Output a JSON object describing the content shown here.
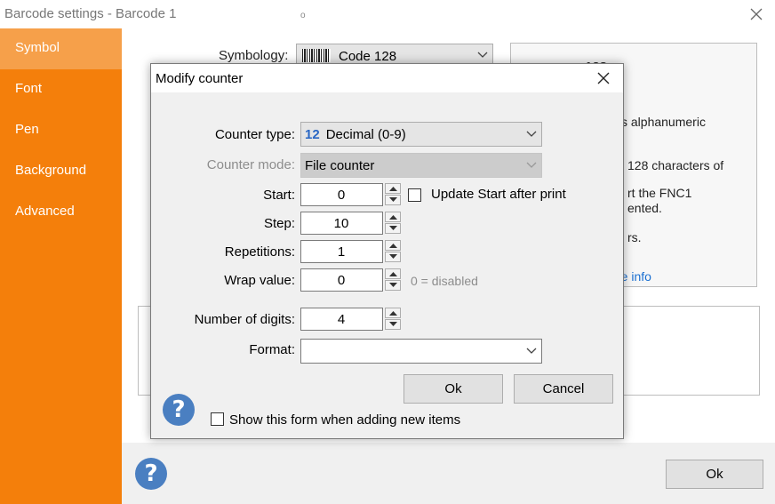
{
  "window": {
    "title": "Barcode settings - Barcode 1",
    "dot": "o"
  },
  "sidebar": {
    "items": [
      {
        "label": "Symbol",
        "active": true
      },
      {
        "label": "Font"
      },
      {
        "label": "Pen"
      },
      {
        "label": "Background"
      },
      {
        "label": "Advanced"
      }
    ]
  },
  "symbology": {
    "label": "Symbology:",
    "value": "Code 128"
  },
  "info": {
    "title": "128",
    "line1": "s alphanumeric",
    "line2": "128 characters of",
    "line3": "rt the FNC1",
    "line4": "ented.",
    "line5": "rs.",
    "link": "re info"
  },
  "footer": {
    "ok_label": "Ok"
  },
  "dialog": {
    "title": "Modify counter",
    "counter_type": {
      "label": "Counter type:",
      "badge": "12",
      "value": "Decimal (0-9)"
    },
    "counter_mode": {
      "label": "Counter mode:",
      "value": "File counter"
    },
    "start": {
      "label": "Start:",
      "value": "0"
    },
    "update_start": {
      "label": "Update Start after print",
      "checked": false
    },
    "step": {
      "label": "Step:",
      "value": "10"
    },
    "repetitions": {
      "label": "Repetitions:",
      "value": "1"
    },
    "wrap": {
      "label": "Wrap value:",
      "value": "0",
      "hint": "0 = disabled"
    },
    "digits": {
      "label": "Number of digits:",
      "value": "4"
    },
    "format": {
      "label": "Format:",
      "value": ""
    },
    "ok_label": "Ok",
    "cancel_label": "Cancel",
    "show_form": {
      "label": "Show this form when adding new items",
      "checked": false
    }
  },
  "colors": {
    "sidebar": "#f47f0b",
    "sidebar_active": "#f6a04a",
    "help": "#4a7fc1",
    "link": "#1a6fd1"
  }
}
